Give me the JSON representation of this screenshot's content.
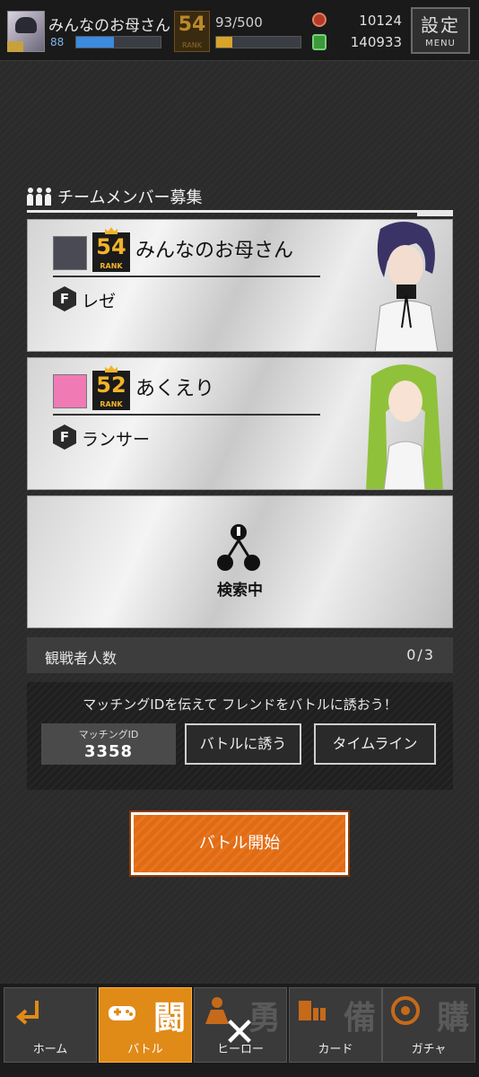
{
  "header": {
    "player_name": "みんなのお母さん",
    "stamina_value": "88",
    "stamina_fraction": 0.45,
    "rank": "54",
    "rank_label": "RANK",
    "exp": "93/500",
    "exp_fraction": 0.19,
    "coins": "10124",
    "gems": "140933",
    "settings_label": "設定",
    "menu_label": "MENU"
  },
  "recruit": {
    "title": "チームメンバー募集",
    "members": [
      {
        "name": "みんなのお母さん",
        "rank": "54",
        "rank_label": "RANK",
        "class_letter": "F",
        "class_name": "レゼ",
        "hair_color": "#3a3466",
        "skin": "#f3ddd0",
        "avatar_color": "#4a4a55"
      },
      {
        "name": "あくえり",
        "rank": "52",
        "rank_label": "RANK",
        "class_letter": "F",
        "class_name": "ランサー",
        "hair_color": "#8fc23a",
        "skin": "#f7e2d3",
        "avatar_color": "#f07ab4"
      }
    ],
    "searching_label": "検索中"
  },
  "spectators": {
    "label": "観戦者人数",
    "count": "0/3"
  },
  "invite": {
    "message": "マッチングIDを伝えて フレンドをバトルに誘おう！",
    "match_id_label": "マッチングID",
    "match_id": "3358",
    "invite_button": "バトルに誘う",
    "timeline_button": "タイムライン"
  },
  "start_button": "バトル開始",
  "nav": [
    {
      "label": "ホーム",
      "kanji": "",
      "icon": "home-arrow-icon",
      "active": false
    },
    {
      "label": "バトル",
      "kanji": "闘",
      "icon": "gamepad-icon",
      "active": true
    },
    {
      "label": "ヒーロー",
      "kanji": "勇",
      "icon": "hero-icon",
      "active": false
    },
    {
      "label": "カード",
      "kanji": "備",
      "icon": "card-icon",
      "active": false
    },
    {
      "label": "ガチャ",
      "kanji": "購",
      "icon": "gacha-icon",
      "active": false
    }
  ],
  "close_symbol": "✕"
}
